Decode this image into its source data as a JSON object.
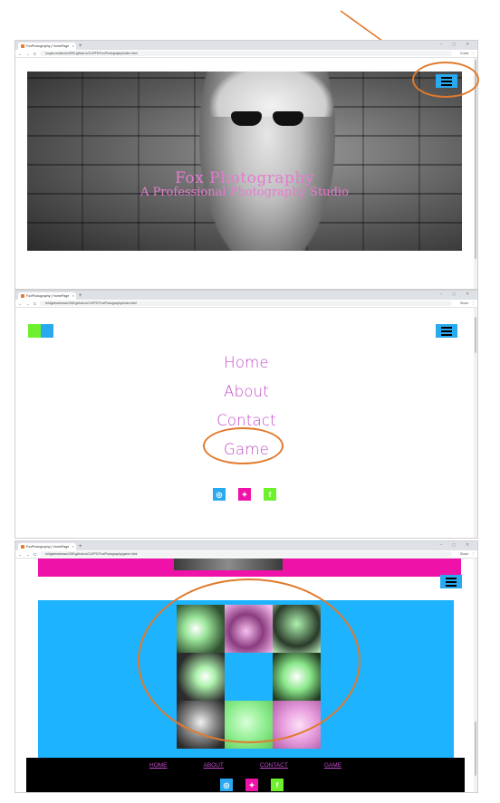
{
  "browser": {
    "tab_title": "FoxPhotography | HomePage",
    "tab_close": "×",
    "new_tab": "+",
    "window_controls": "–  ◻  ✕",
    "nav_back": "←",
    "nav_forward": "→",
    "nav_reload": "C",
    "frame1_url": "lucyan-mckeown1990.github.io/CUPFE/FoxPhotography/index.html",
    "frame2_url": "bridgetmckeown1990.github.io/CUPFE/FoxPhotography/index.html",
    "frame3_url": "bridgetmckeown1990.github.io/CUPFE/FoxPhotography/game.html",
    "frame1_ext": "Guest",
    "frame2_ext": "Share",
    "frame3_ext": "Share",
    "menu_dots": "⋮"
  },
  "hero": {
    "title": "Fox Photography",
    "subtitle": "A Professional Photography Studio"
  },
  "menu": {
    "items": [
      "Home",
      "About",
      "Contact",
      "Game"
    ]
  },
  "social": {
    "instagram_glyph": "◎",
    "twitter_glyph": "✦",
    "facebook_glyph": "f"
  },
  "footer": {
    "nav": [
      "HOME",
      "ABOUT",
      "CONTACT",
      "GAME"
    ]
  },
  "colors": {
    "accent_blue": "#29a9f0",
    "accent_pink": "#ee12a8",
    "accent_green": "#6ef02d",
    "annotation_orange": "#e07a2d",
    "menu_text": "#c24ac9"
  }
}
